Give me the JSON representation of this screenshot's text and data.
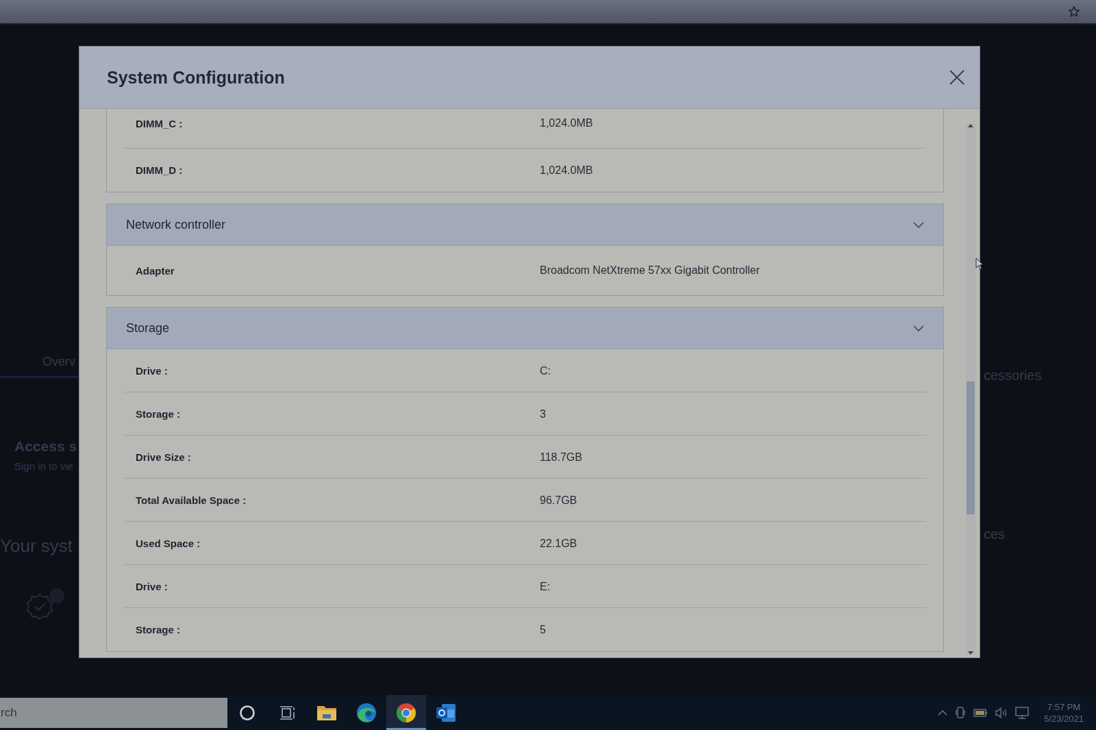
{
  "background_page": {
    "tab": "Overv",
    "access_title": "Access s",
    "access_text": "Sign in to vie",
    "section_title": "Your syst",
    "right_texts": [
      "cessories",
      "ces"
    ]
  },
  "dialog": {
    "title": "System Configuration",
    "sections": [
      {
        "rows": [
          {
            "label": "DIMM_C :",
            "value": "1,024.0MB"
          },
          {
            "label": "DIMM_D :",
            "value": "1,024.0MB"
          }
        ]
      },
      {
        "title": "Network controller",
        "expanded": true,
        "rows": [
          {
            "label": "Adapter",
            "value": "Broadcom NetXtreme 57xx Gigabit Controller"
          }
        ]
      },
      {
        "title": "Storage",
        "expanded": true,
        "rows": [
          {
            "label": "Drive :",
            "value": "C:"
          },
          {
            "label": "Storage :",
            "value": "3"
          },
          {
            "label": "Drive Size :",
            "value": "118.7GB"
          },
          {
            "label": "Total Available Space :",
            "value": "96.7GB"
          },
          {
            "label": "Used Space :",
            "value": "22.1GB"
          },
          {
            "label": "Drive :",
            "value": "E:"
          },
          {
            "label": "Storage :",
            "value": "5"
          }
        ]
      }
    ]
  },
  "taskbar": {
    "search": {
      "placeholder": "rch"
    },
    "apps": [
      {
        "kind": "ring",
        "selected": false
      },
      {
        "kind": "task_view",
        "selected": false
      },
      {
        "kind": "folder",
        "selected": false
      },
      {
        "kind": "wave",
        "selected": false
      },
      {
        "kind": "tricolor",
        "selected": true
      },
      {
        "kind": "mail",
        "selected": false
      }
    ],
    "clock": {
      "time": "7:57 PM",
      "date": "5/23/2021"
    }
  }
}
